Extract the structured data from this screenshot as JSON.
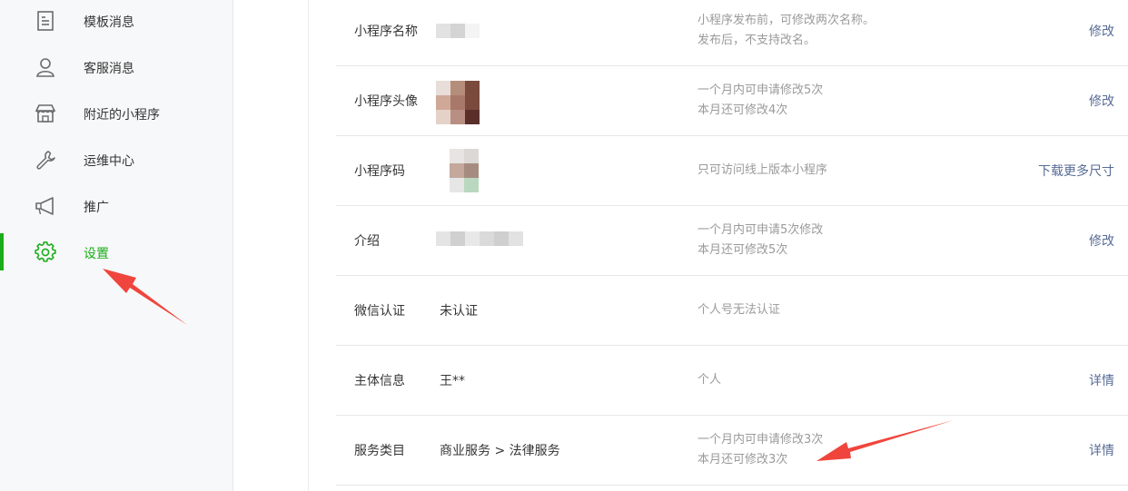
{
  "sidebar": {
    "items": [
      {
        "label": "模板消息",
        "icon": "document-list-icon"
      },
      {
        "label": "客服消息",
        "icon": "user-icon"
      },
      {
        "label": "附近的小程序",
        "icon": "store-icon"
      },
      {
        "label": "运维中心",
        "icon": "wrench-icon"
      },
      {
        "label": "推广",
        "icon": "megaphone-icon"
      },
      {
        "label": "设置",
        "icon": "gear-icon",
        "active": true
      }
    ]
  },
  "settings": {
    "rows": [
      {
        "name": "小程序名称",
        "value": "",
        "tips": [
          "小程序发布前，可修改两次名称。",
          "发布后，不支持改名。"
        ],
        "action": "修改"
      },
      {
        "name": "小程序头像",
        "value": "",
        "tips": [
          "一个月内可申请修改5次",
          "本月还可修改4次"
        ],
        "action": "修改"
      },
      {
        "name": "小程序码",
        "value": "",
        "tips": [
          "只可访问线上版本小程序"
        ],
        "action": "下载更多尺寸"
      },
      {
        "name": "介绍",
        "value": "",
        "tips": [
          "一个月内可申请5次修改",
          "本月还可修改5次"
        ],
        "action": "修改"
      },
      {
        "name": "微信认证",
        "value": "未认证",
        "tips": [
          "个人号无法认证"
        ],
        "action": ""
      },
      {
        "name": "主体信息",
        "value": "王**",
        "tips": [
          "个人"
        ],
        "action": "详情"
      },
      {
        "name": "服务类目",
        "value": "商业服务 > 法律服务",
        "tips": [
          "一个月内可申请修改3次",
          "本月还可修改3次"
        ],
        "action": "详情"
      }
    ]
  },
  "colors": {
    "accent": "#1aad19",
    "link": "#576b95",
    "annotation_arrow": "#f0453c"
  }
}
